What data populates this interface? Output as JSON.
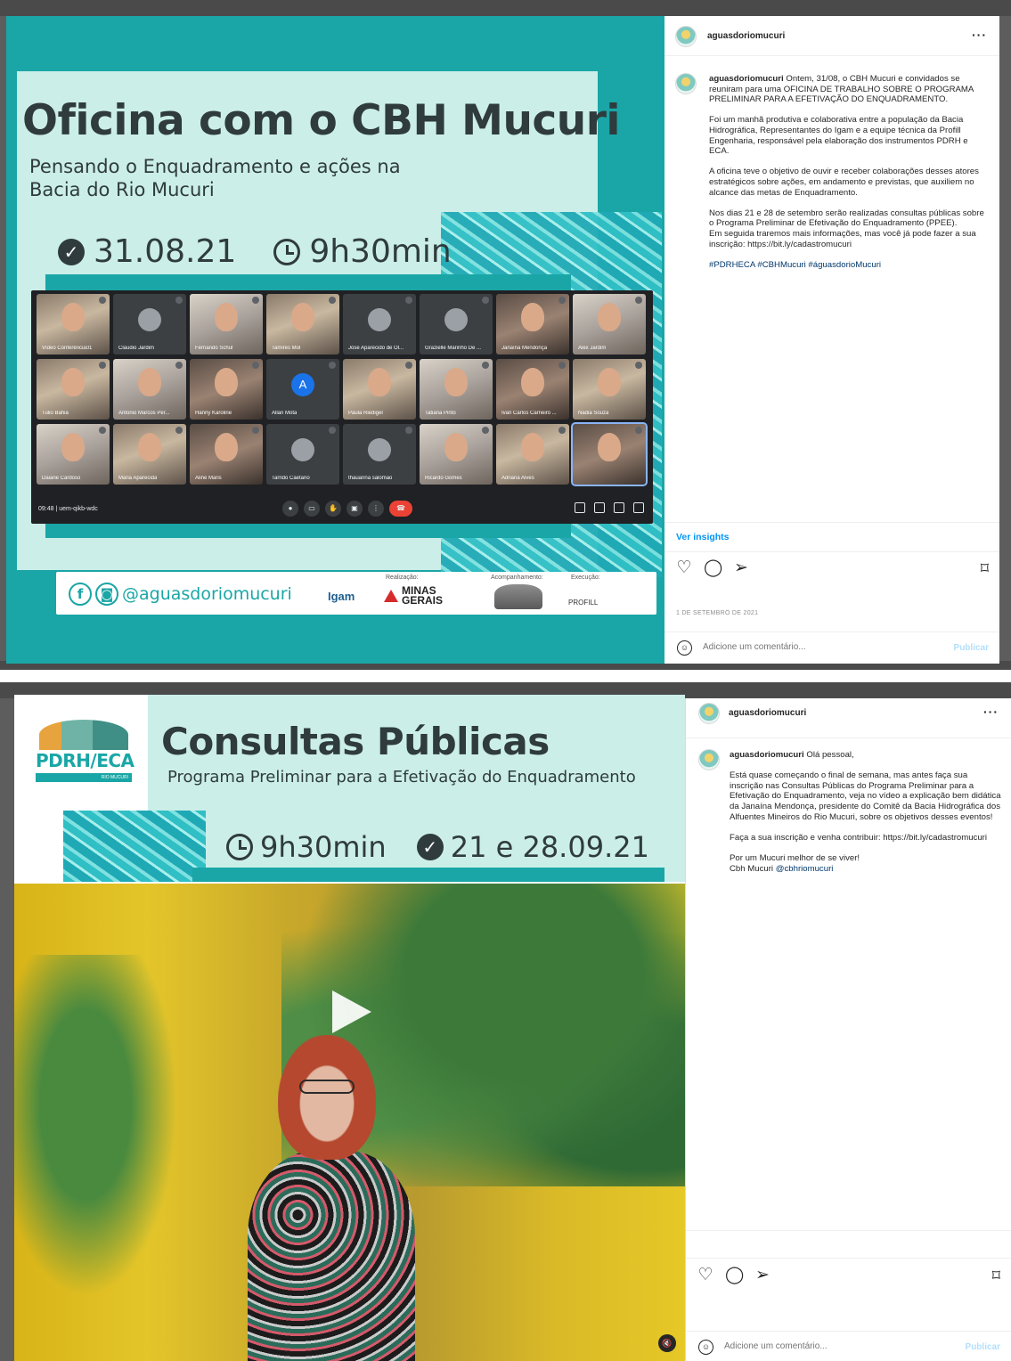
{
  "post1": {
    "image": {
      "title": "Oficina com o CBH Mucuri",
      "subtitle": "Pensando o Enquadramento e ações na Bacia do Rio Mucuri",
      "date": "31.08.21",
      "time": "9h30min",
      "meet": {
        "time_code": "09:48 | uem-qikb-wdc",
        "participants": [
          "Vídeo Conferência01",
          "Claudio Jardim",
          "Fernando Schul",
          "Tamires Mol",
          "Jose Aparecido de Ol...",
          "Grazielle Marinho De ...",
          "Janaína Mendonça",
          "Alex Jardim",
          "Tulio Bahia",
          "Antonio Marcos Per...",
          "Hanny Karoline",
          "Allan Mota",
          "Paula Riediger",
          "Tatiana Pinto",
          "Ivan Carlos Carneiro ...",
          "Nadia Souza",
          "Daiane Cardoso",
          "Maria Aparecida",
          "Aline Maris",
          "Tarrido Caetano",
          "thauanna salomao",
          "Ricardo Gomes",
          "Adriana Alves",
          ""
        ],
        "avatar_letter": "A"
      },
      "footer": {
        "handle": "@aguasdoriomucuri",
        "facebook_glyph": "f",
        "instagram_glyph": "◙",
        "label_realizacao": "Realização:",
        "label_acompanhamento": "Acompanhamento:",
        "label_execucao": "Execução:",
        "logo_igam": "Igam",
        "logo_mg": "MINAS GERAIS",
        "logo_profill": "PROFILL"
      }
    },
    "panel": {
      "username": "aguasdoriomucuri",
      "more": "···",
      "caption_user": "aguasdoriomucuri",
      "caption_p1": "Ontem, 31/08, o CBH Mucuri e convidados se reuniram para uma OFICINA DE TRABALHO SOBRE O PROGRAMA PRELIMINAR PARA A EFETIVAÇÃO DO ENQUADRAMENTO.",
      "caption_p2": "Foi um manhã produtiva e colaborativa entre a população da Bacia Hidrográfica, Representantes do Igam e a equipe técnica da Profill Engenharia, responsável pela elaboração dos instrumentos PDRH e ECA.",
      "caption_p3": "A oficina teve o objetivo de ouvir e receber colaborações desses atores estratégicos sobre ações, em andamento e previstas, que auxiliem no alcance das metas de Enquadramento.",
      "caption_p4": "Nos dias 21 e 28 de setembro serão realizadas consultas públicas sobre o Programa Preliminar de Efetivação do Enquadramento (PPEE).",
      "caption_p5": "Em seguida traremos mais informações, mas você já pode fazer a sua inscrição: https://bit.ly/cadastromucuri",
      "hashtags": "#PDRHECA #CBHMucuri #águasdorioMucuri",
      "insights": "Ver insights",
      "date": "1 DE SETEMBRO DE 2021",
      "comment_placeholder": "Adicione um comentário...",
      "publish": "Publicar"
    }
  },
  "post2": {
    "image": {
      "logo_text": "PDRH/ECA",
      "logo_sub": "RIO MUCURI",
      "title": "Consultas Públicas",
      "subtitle": "Programa Preliminar para a Efetivação do Enquadramento",
      "time": "9h30min",
      "dates": "21 e 28.09.21"
    },
    "panel": {
      "username": "aguasdoriomucuri",
      "more": "···",
      "caption_user": "aguasdoriomucuri",
      "caption_greeting": "Olá pessoal,",
      "caption_p1": "Está quase começando o final de semana, mas antes faça sua inscrição nas Consultas Públicas do Programa Preliminar para a Efetivação do Enquadramento, veja no vídeo a explicação bem didática da Janaína Mendonça, presidente do Comitê da Bacia Hidrográfica dos Alfuentes Mineiros do Rio Mucuri, sobre os objetivos desses eventos!",
      "caption_p2": "Faça a sua inscrição e venha contribuir: https://bit.ly/cadastromucuri",
      "caption_p3a": "Por um Mucuri melhor de se viver!",
      "caption_p3b": "Cbh Mucuri",
      "caption_mention": "@cbhriomucuri",
      "comment_placeholder": "Adicione um comentário...",
      "publish": "Publicar"
    }
  },
  "icons": {
    "like": "♡",
    "comment": "◯",
    "share": "➢",
    "save": "⌑",
    "emoji": "☺",
    "mute": "🔇",
    "check": "✓"
  },
  "colors": {
    "teal": "#1aa6a6",
    "mint": "#cbeee9",
    "ig_blue": "#0095f6",
    "meet_dark": "#202124",
    "end_call": "#ea4335"
  }
}
